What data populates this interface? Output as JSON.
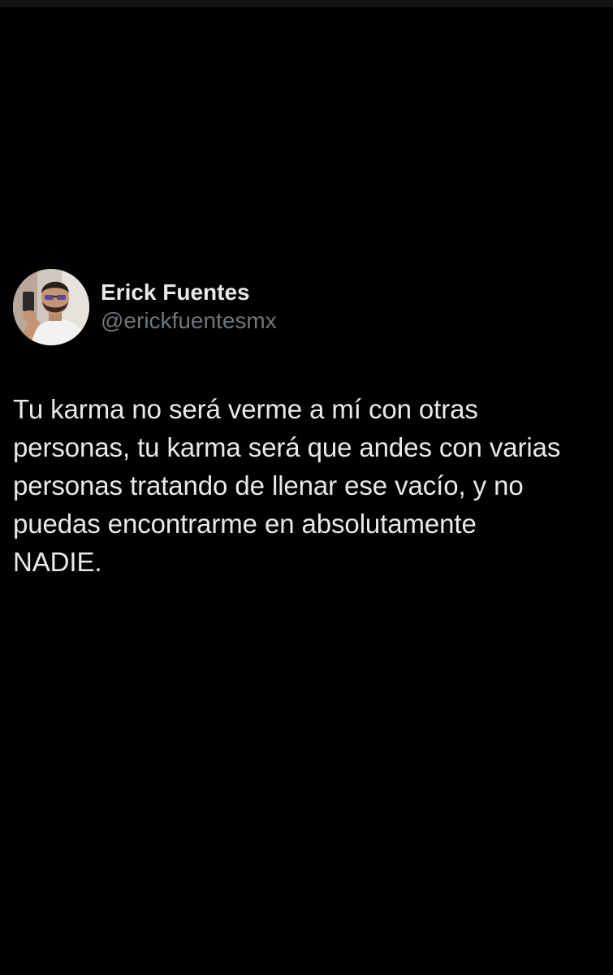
{
  "author": {
    "display_name": "Erick Fuentes",
    "handle": "@erickfuentesmx"
  },
  "tweet": {
    "text": "Tu karma no será verme a mí con otras\npersonas, tu karma será que andes con varias\npersonas tratando de llenar ese vacío, y no\npuedas encontrarme en absolutamente\nNADIE."
  },
  "colors": {
    "background": "#000000",
    "primary_text": "#e7e9ea",
    "secondary_text": "#71767b"
  }
}
